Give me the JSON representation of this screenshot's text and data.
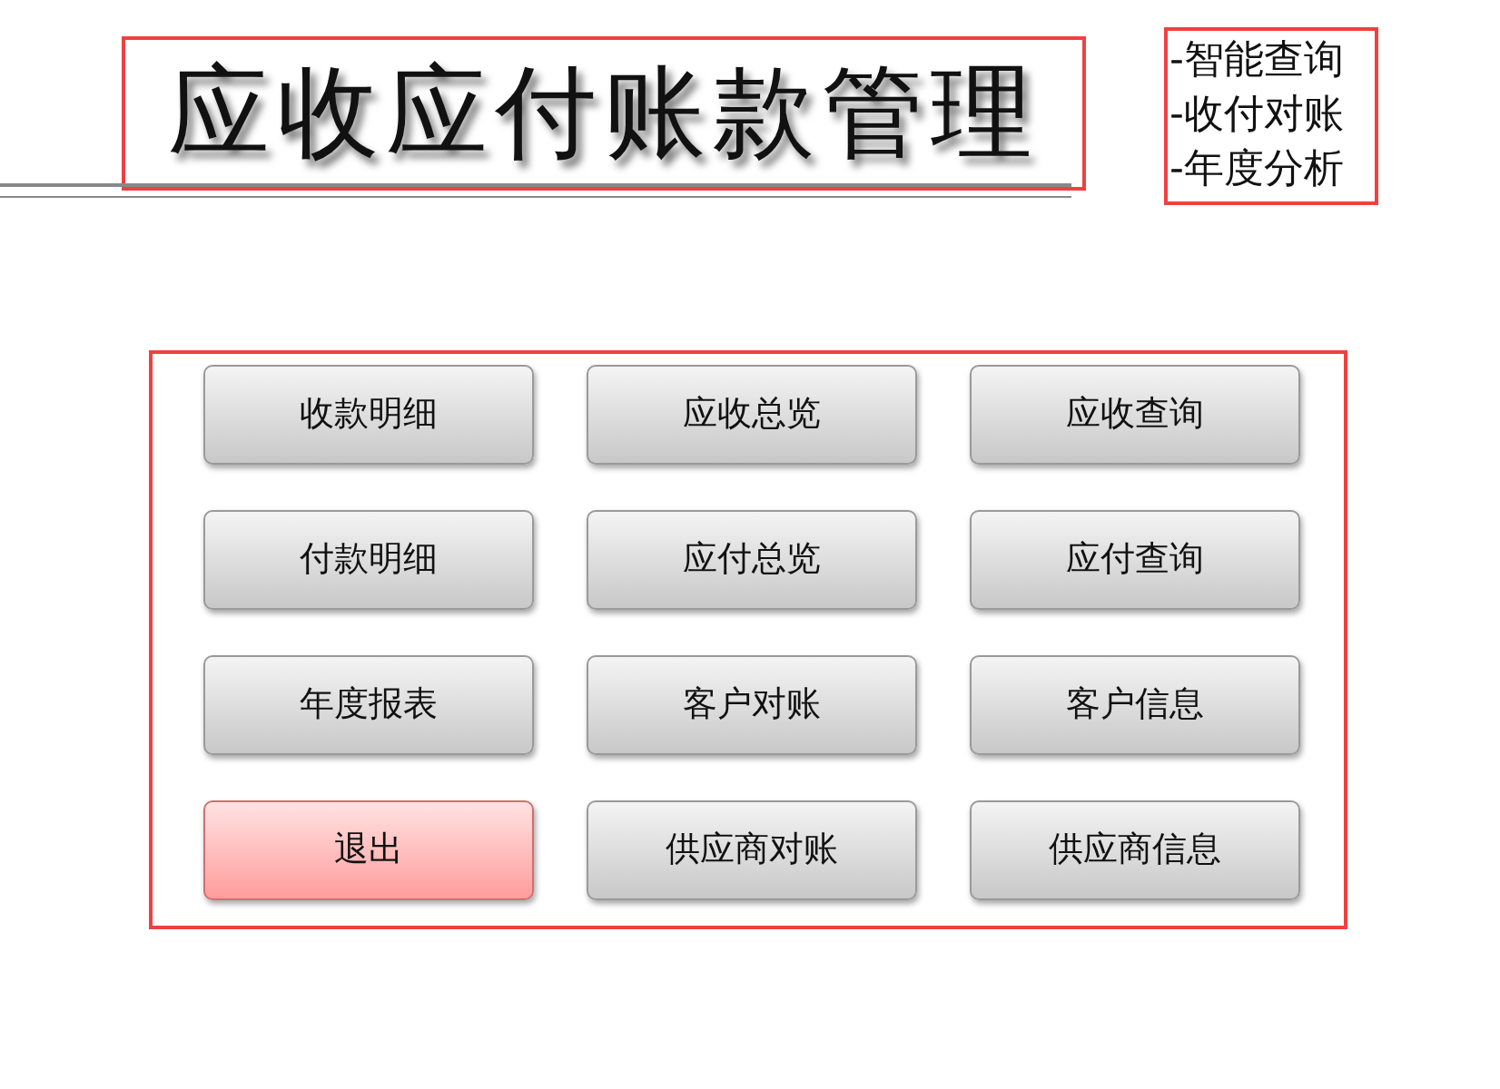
{
  "title": "应收应付账款管理",
  "features": [
    "-智能查询",
    "-收付对账",
    "-年度分析"
  ],
  "buttons": [
    {
      "label": "收款明细",
      "kind": "normal"
    },
    {
      "label": "应收总览",
      "kind": "normal"
    },
    {
      "label": "应收查询",
      "kind": "normal"
    },
    {
      "label": "付款明细",
      "kind": "normal"
    },
    {
      "label": "应付总览",
      "kind": "normal"
    },
    {
      "label": "应付查询",
      "kind": "normal"
    },
    {
      "label": "年度报表",
      "kind": "normal"
    },
    {
      "label": "客户对账",
      "kind": "normal"
    },
    {
      "label": "客户信息",
      "kind": "normal"
    },
    {
      "label": "退出",
      "kind": "exit"
    },
    {
      "label": "供应商对账",
      "kind": "normal"
    },
    {
      "label": "供应商信息",
      "kind": "normal"
    }
  ]
}
